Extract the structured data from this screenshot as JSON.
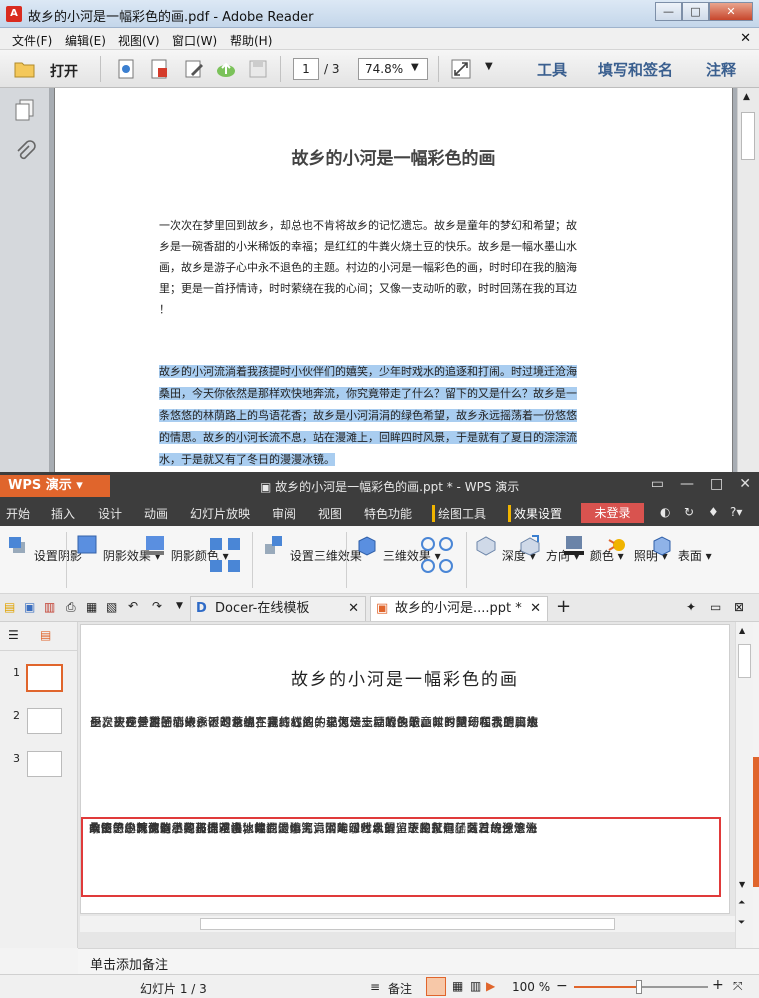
{
  "reader": {
    "window_title": "故乡的小河是一幅彩色的画.pdf - Adobe Reader",
    "menu": [
      "文件(F)",
      "编辑(E)",
      "视图(V)",
      "窗口(W)",
      "帮助(H)"
    ],
    "toolbar": {
      "open_label": "打开",
      "page_current": "1",
      "page_total": "/ 3",
      "zoom": "74.8%",
      "tools": "工具",
      "fill_sign": "填写和签名",
      "comment": "注释"
    },
    "doc": {
      "title": "故乡的小河是一幅彩色的画",
      "para1": [
        "一次次在梦里回到故乡，却总也不肯将故乡的记忆遗忘。故乡是童年的梦幻和希望；故",
        "乡是一碗香甜的小米稀饭的幸福；是红红的牛粪火烧土豆的快乐。故乡是一幅水墨山水",
        "画，故乡是游子心中永不退色的主题。村边的小河是一幅彩色的画，时时印在我的脑海",
        "里；更是一首抒情诗，时时萦绕在我的心间；又像一支动听的歌，时时回荡在我的耳边",
        "！"
      ],
      "para2": [
        "故乡的小河流淌着我孩提时小伙伴们的嬉笑，少年时戏水的追逐和打闹。时过境迁沧海",
        "桑田，今天你依然是那样欢快地奔流，你究竟带走了什么？留下的又是什么？故乡是一",
        "条悠悠的林荫路上的鸟语花香；故乡是小河涓涓的绿色希望，故乡永远摇荡着一份悠悠",
        "的情思。故乡的小河长流不息，站在漫滩上，回眸四时风景，于是就有了夏日的淙淙流",
        "水，于是就又有了冬日的漫漫冰镜。"
      ]
    }
  },
  "wps": {
    "app_name": "WPS 演示",
    "window_title": "故乡的小河是一幅彩色的画.ppt * - WPS 演示",
    "menu": [
      "开始",
      "插入",
      "设计",
      "动画",
      "幻灯片放映",
      "审阅",
      "视图",
      "特色功能",
      "绘图工具",
      "效果设置"
    ],
    "login": "未登录",
    "ribbon": [
      "设置阴影",
      "阴影效果",
      "阴影颜色",
      "设置三维效果",
      "三维效果",
      "深度",
      "方向",
      "颜色",
      "照明",
      "表面"
    ],
    "tabs": {
      "docer": "Docer-在线模板",
      "doc": "故乡的小河是....ppt *"
    },
    "thumbnails": [
      "1",
      "2",
      "3"
    ],
    "slide": {
      "title": "故乡的小河是一幅彩色的画",
      "para1": [
        "一次次在梦里回到故乡，却总也不肯将故乡的记忆遗忘。故乡是童年的梦幻和希望；故",
        "乡是一碗香甜的小米稀饭的幸福；是红红的牛粪火烧土豆的快乐。故乡是一幅水墨山水",
        "画，故乡是游子心中永不退色的主题。村边的小河是一幅彩色的画，时时印在我的脑海",
        "里；更是一首抒情诗，时时萦绕在我的心间；又像一支动听的歌，时时回荡在我的耳边",
        "！"
      ],
      "para2": [
        "故乡的小河流淌着我孩提时小伙伴们的嬉笑，少年时戏水的追逐和打闹。时过境迁沧海",
        "桑田，今天你依然是那样欢快地奔流，你究竟带走了什么？留下的又是什么？故乡是一",
        "条悠悠的林荫路上的鸟语花香；故乡是小河涓涓的绿色希望，故乡永远摇荡着一份悠悠",
        "的情思。故乡的小河长流不息，站在漫滩上，回眸四时风景，于是就有了夏日的淙淙流",
        "水，于是就又有了冬日的漫漫冰镜。"
      ]
    },
    "notes_placeholder": "单击添加备注",
    "status": {
      "slide": "幻灯片 1 / 3",
      "notes": "备注",
      "zoom": "100 %"
    }
  }
}
